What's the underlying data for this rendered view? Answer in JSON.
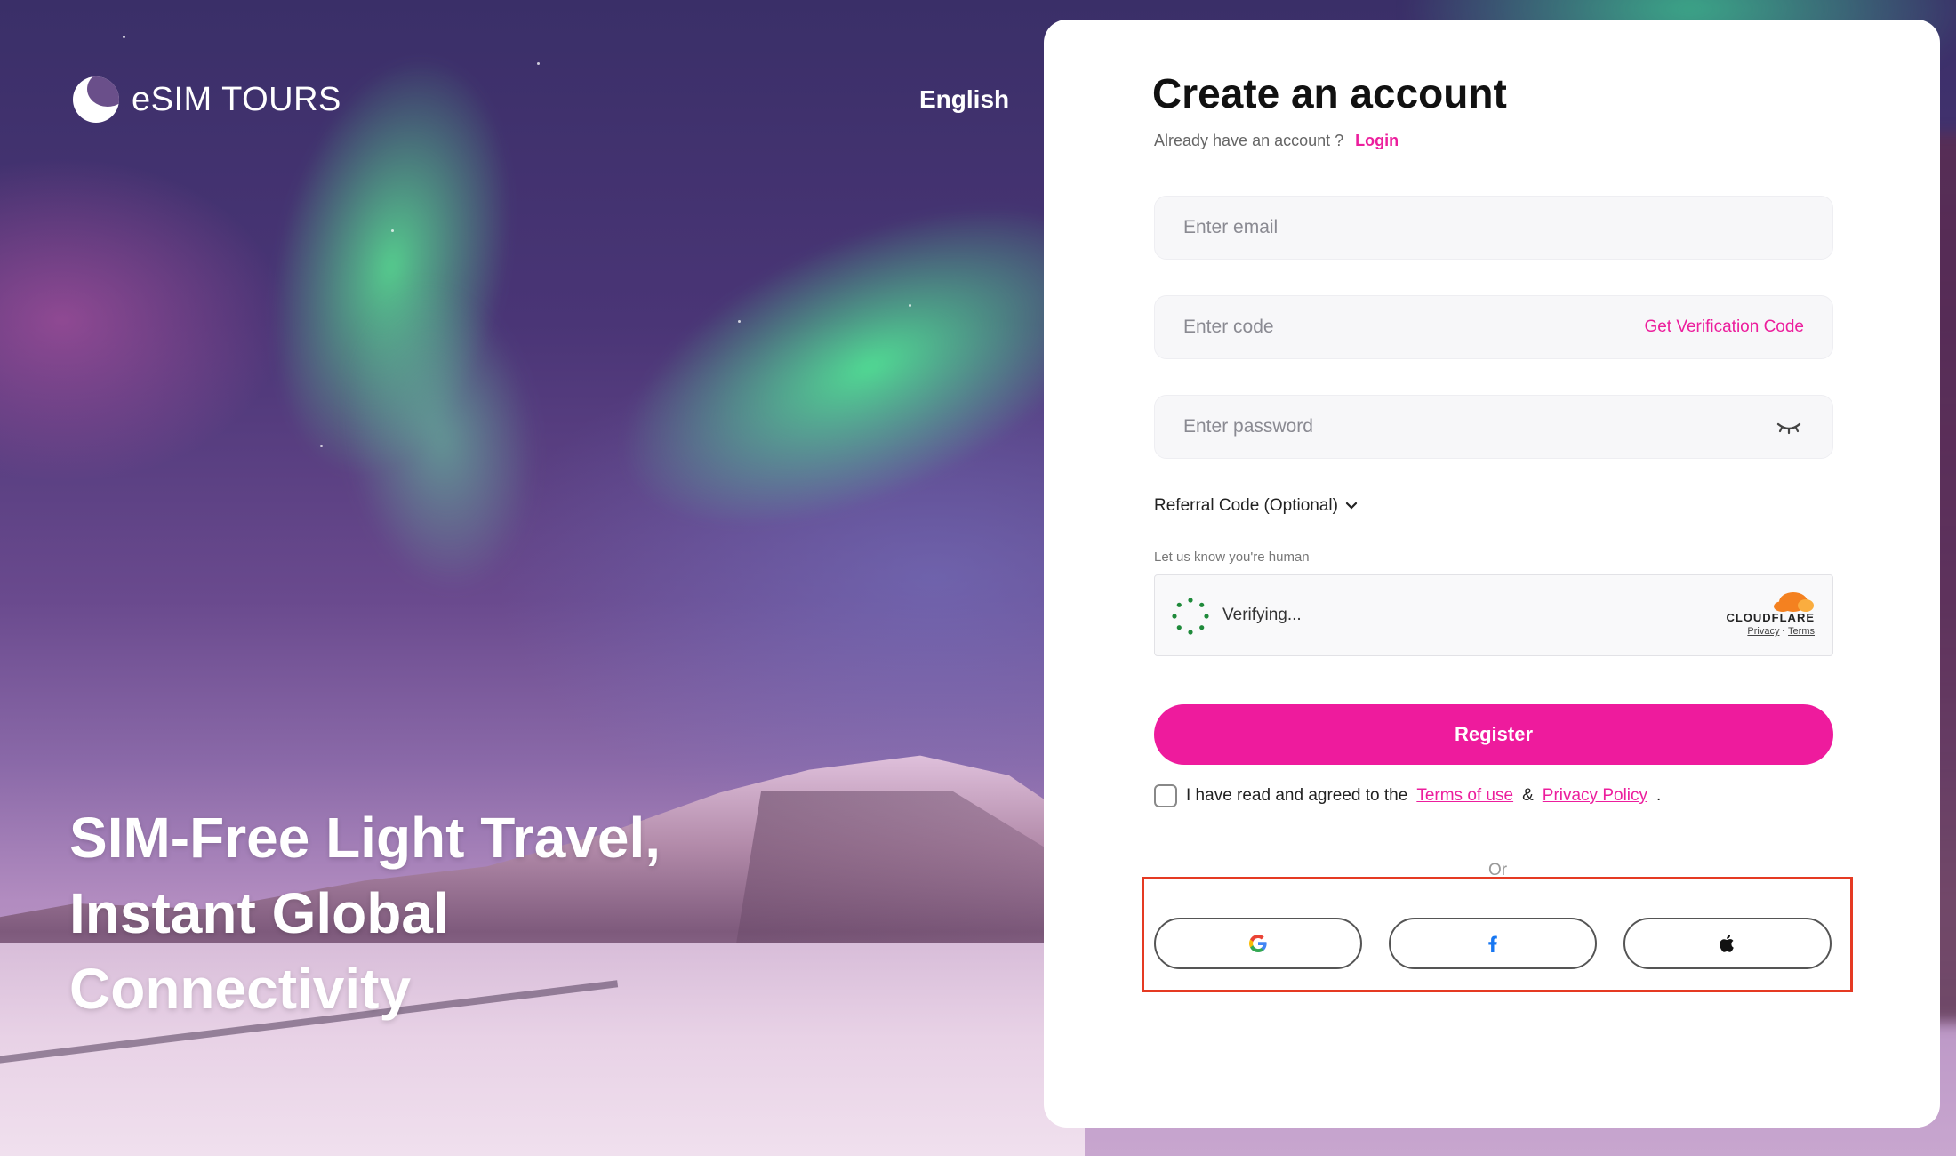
{
  "brand": {
    "name": "eSIM TOURS"
  },
  "header": {
    "language": "English"
  },
  "hero": {
    "headline": "SIM-Free Light Travel, Instant Global Connectivity"
  },
  "form": {
    "title": "Create an account",
    "already_text": "Already have an account ?",
    "login_link": "Login",
    "email_placeholder": "Enter email",
    "code_placeholder": "Enter code",
    "get_code_label": "Get Verification Code",
    "password_placeholder": "Enter password",
    "referral_label": "Referral Code (Optional)",
    "human_label": "Let us know you're human",
    "captcha": {
      "status": "Verifying...",
      "provider": "CLOUDFLARE",
      "privacy": "Privacy",
      "separator": "·",
      "terms": "Terms"
    },
    "register_label": "Register",
    "agree_prefix": "I have read and agreed to the",
    "terms_link": "Terms of use",
    "amp": "&",
    "privacy_link": "Privacy Policy",
    "agree_suffix": ".",
    "or_label": "Or"
  },
  "social": [
    {
      "icon": "google-icon"
    },
    {
      "icon": "facebook-icon"
    },
    {
      "icon": "apple-icon"
    }
  ],
  "colors": {
    "accent": "#ec1e9d",
    "highlight_box": "#e53a23",
    "cloudflare_orange": "#f48120"
  }
}
